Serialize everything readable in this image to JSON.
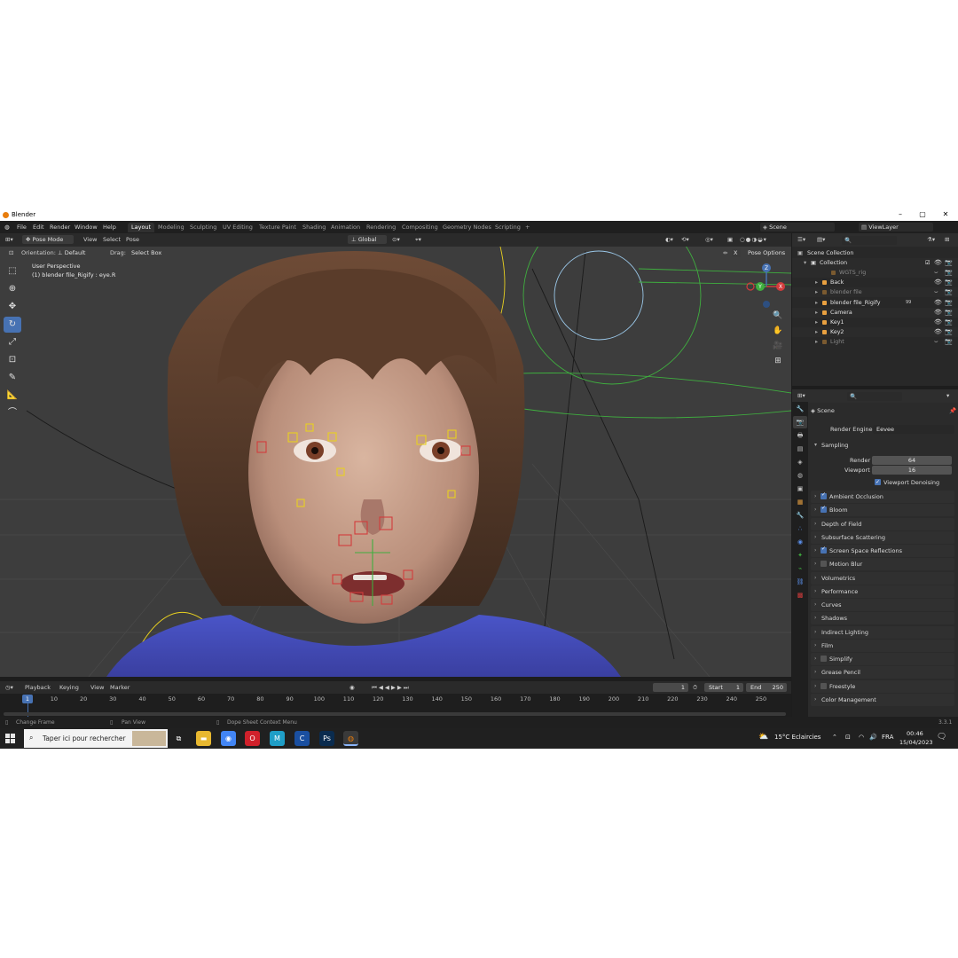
{
  "window": {
    "title": "Blender",
    "minimize": "–",
    "maximize": "▢",
    "close": "✕"
  },
  "menu": [
    "File",
    "Edit",
    "Render",
    "Window",
    "Help"
  ],
  "workspaces": [
    "Layout",
    "Modeling",
    "Sculpting",
    "UV Editing",
    "Texture Paint",
    "Shading",
    "Animation",
    "Rendering",
    "Compositing",
    "Geometry Nodes",
    "Scripting"
  ],
  "active_workspace": "Layout",
  "add_workspace": "+",
  "scene_name": "Scene",
  "view_layer": "ViewLayer",
  "viewport_header": {
    "mode": "Pose Mode",
    "view": "View",
    "select": "Select",
    "pose": "Pose",
    "transform_orientation": "Global"
  },
  "tool_settings": {
    "orientation_label": "Orientation:",
    "orientation_value": "Default",
    "drag_label": "Drag:",
    "drag_value": "Select Box",
    "pose_options": "Pose Options",
    "x_label": "X"
  },
  "viewport_info": {
    "line1": "User Perspective",
    "line2": "(1) blender file_Rigify : eye.R"
  },
  "gizmo": {
    "x": "X",
    "y": "Y",
    "z": "Z"
  },
  "timeline": {
    "playback": "Playback",
    "keying": "Keying",
    "view": "View",
    "marker": "Marker",
    "current_frame": "1",
    "start_label": "Start",
    "start": "1",
    "end_label": "End",
    "end": "250",
    "ticks": [
      "1",
      "10",
      "20",
      "30",
      "40",
      "50",
      "60",
      "70",
      "80",
      "90",
      "100",
      "110",
      "120",
      "130",
      "140",
      "150",
      "160",
      "170",
      "180",
      "190",
      "200",
      "210",
      "220",
      "230",
      "240",
      "250"
    ]
  },
  "statusbar": {
    "left": "Change Frame",
    "mid": "Pan View",
    "right": "Dope Sheet Context Menu",
    "version": "3.3.1"
  },
  "outliner": {
    "scene_collection": "Scene Collection",
    "collection": "Collection",
    "items": [
      {
        "name": "WGTS_rig",
        "dim": true,
        "indent": 2
      },
      {
        "name": "Back",
        "dim": false,
        "indent": 1
      },
      {
        "name": "blender file",
        "dim": true,
        "indent": 1
      },
      {
        "name": "blender file_Rigify",
        "dim": false,
        "indent": 1
      },
      {
        "name": "Camera",
        "dim": false,
        "indent": 1
      },
      {
        "name": "Key1",
        "dim": false,
        "indent": 1
      },
      {
        "name": "Key2",
        "dim": false,
        "indent": 1
      },
      {
        "name": "Light",
        "dim": true,
        "indent": 1
      }
    ],
    "badge": "99"
  },
  "properties": {
    "context": "Scene",
    "render_engine_label": "Render Engine",
    "render_engine": "Eevee",
    "sampling": "Sampling",
    "render_label": "Render",
    "render_samples": "64",
    "viewport_label": "Viewport",
    "viewport_samples": "16",
    "viewport_denoising": "Viewport Denoising",
    "panels": [
      {
        "label": "Ambient Occlusion",
        "checkbox": true,
        "checked": true
      },
      {
        "label": "Bloom",
        "checkbox": true,
        "checked": true
      },
      {
        "label": "Depth of Field",
        "checkbox": false,
        "checked": false
      },
      {
        "label": "Subsurface Scattering",
        "checkbox": false,
        "checked": false
      },
      {
        "label": "Screen Space Reflections",
        "checkbox": true,
        "checked": true
      },
      {
        "label": "Motion Blur",
        "checkbox": true,
        "checked": false
      },
      {
        "label": "Volumetrics",
        "checkbox": false,
        "checked": false
      },
      {
        "label": "Performance",
        "checkbox": false,
        "checked": false
      },
      {
        "label": "Curves",
        "checkbox": false,
        "checked": false
      },
      {
        "label": "Shadows",
        "checkbox": false,
        "checked": false
      },
      {
        "label": "Indirect Lighting",
        "checkbox": false,
        "checked": false
      },
      {
        "label": "Film",
        "checkbox": false,
        "checked": false
      },
      {
        "label": "Simplify",
        "checkbox": true,
        "checked": false
      },
      {
        "label": "Grease Pencil",
        "checkbox": false,
        "checked": false
      },
      {
        "label": "Freestyle",
        "checkbox": true,
        "checked": false
      },
      {
        "label": "Color Management",
        "checkbox": false,
        "checked": false
      }
    ]
  },
  "taskbar": {
    "search_placeholder": "Taper ici pour rechercher",
    "apps": [
      {
        "name": "task-view",
        "glyph": "⧉"
      },
      {
        "name": "file-explorer",
        "glyph": "▬"
      },
      {
        "name": "chrome",
        "glyph": "◉"
      },
      {
        "name": "opera",
        "glyph": "O"
      },
      {
        "name": "app-m",
        "glyph": "M"
      },
      {
        "name": "app-c",
        "glyph": "C"
      },
      {
        "name": "photoshop",
        "glyph": "Ps"
      },
      {
        "name": "blender",
        "glyph": "◍"
      }
    ],
    "weather": "15°C  Eclaircies",
    "language": "FRA",
    "time": "00:46",
    "date": "15/04/2023"
  },
  "colors": {
    "accent": "#4772b3",
    "blender_orange": "#e87d0d",
    "bone_yellow": "#e8d020",
    "bone_red": "#d23c3c",
    "bone_green": "#3fae3f"
  }
}
